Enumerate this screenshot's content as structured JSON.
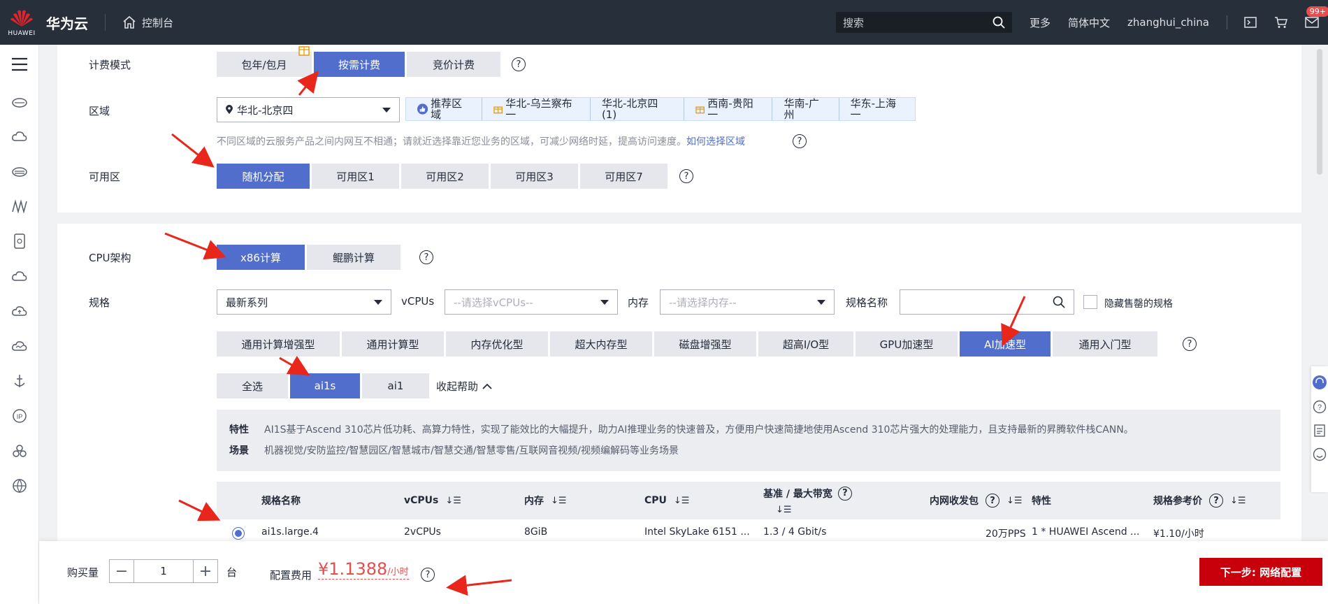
{
  "topbar": {
    "logo_text": "HUAWEI",
    "brand": "华为云",
    "console": "控制台",
    "search_placeholder": "搜索",
    "links": [
      "更多",
      "简体中文",
      "zhanghui_china"
    ],
    "badge": "99+"
  },
  "billing": {
    "label": "计费模式",
    "options": [
      "包年/包月",
      "按需计费",
      "竞价计费"
    ],
    "selected": "按需计费"
  },
  "region": {
    "label": "区域",
    "value": "华北-北京四",
    "recommended_label": "推荐区域",
    "tags": [
      "华北-乌兰察布一",
      "华北-北京四 (1)",
      "西南-贵阳一",
      "华南-广州",
      "华东-上海一"
    ],
    "tip": "不同区域的云服务产品之间内网互不相通；请就近选择靠近您业务的区域，可减少网络时延，提高访问速度。",
    "tip_link": "如何选择区域"
  },
  "az": {
    "label": "可用区",
    "options": [
      "随机分配",
      "可用区1",
      "可用区2",
      "可用区3",
      "可用区7"
    ],
    "selected": "随机分配"
  },
  "cpu_arch": {
    "label": "CPU架构",
    "options": [
      "x86计算",
      "鲲鹏计算"
    ],
    "selected": "x86计算"
  },
  "spec": {
    "label": "规格",
    "series_value": "最新系列",
    "vcpus_label": "vCPUs",
    "vcpus_placeholder": "--请选择vCPUs--",
    "mem_label": "内存",
    "mem_placeholder": "--请选择内存--",
    "name_label": "规格名称",
    "hide_soldout": "隐藏售罄的规格",
    "types": [
      "通用计算增强型",
      "通用计算型",
      "内存优化型",
      "超大内存型",
      "磁盘增强型",
      "超高I/O型",
      "GPU加速型",
      "AI加速型",
      "通用入门型"
    ],
    "selected_type": "AI加速型",
    "subtypes": [
      "全选",
      "ai1s",
      "ai1"
    ],
    "selected_subtype": "ai1s",
    "collapse_help": "收起帮助"
  },
  "info": {
    "feature_key": "特性",
    "feature_text": "AI1S基于Ascend 310芯片低功耗、高算力特性，实现了能效比的大幅提升，助力AI推理业务的快速普及，方便用户快速简捷地使用Ascend 310芯片强大的处理能力，且支持最新的昇腾软件栈CANN。",
    "scene_key": "场景",
    "scene_text": "机器视觉/安防监控/智慧园区/智慧城市/智慧交通/智慧零售/互联网音视频/视频编解码等业务场景"
  },
  "table": {
    "headers": [
      "规格名称",
      "vCPUs",
      "内存",
      "CPU",
      "基准 / 最大带宽",
      "内网收发包",
      "特性",
      "规格参考价"
    ],
    "row": [
      "ai1s.large.4",
      "2vCPUs",
      "8GiB",
      "Intel SkyLake 6151 ...",
      "1.3 / 4 Gbit/s",
      "20万PPS",
      "1 * HUAWEI Ascend ...",
      "¥1.10/小时"
    ]
  },
  "bottom": {
    "qty_label": "购买量",
    "qty": "1",
    "unit": "台",
    "fee_label": "配置费用",
    "fee": "¥1.1388",
    "fee_unit": "/小时",
    "next": "下一步: 网络配置"
  },
  "colors": {
    "accent": "#526ecc",
    "red": "#c7000b",
    "topbar": "#272f3a"
  }
}
